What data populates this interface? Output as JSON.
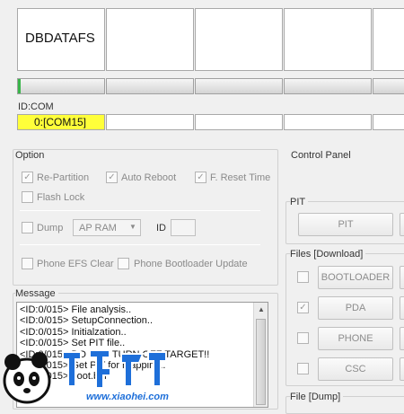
{
  "port_header": {
    "slot1_label": "DBDATAFS"
  },
  "progress": {
    "slot1_fill": 0.03
  },
  "idcom": {
    "label": "ID:COM",
    "slot1_value": "0:[COM15]"
  },
  "option": {
    "title": "Option",
    "repartition": "Re-Partition",
    "auto_reboot": "Auto Reboot",
    "f_reset_time": "F. Reset Time",
    "flash_lock": "Flash Lock",
    "dump": "Dump",
    "dump_select": "AP RAM",
    "id_label": "ID",
    "phone_efs_clear": "Phone EFS Clear",
    "phone_bootloader_update": "Phone Bootloader Update"
  },
  "message": {
    "title": "Message",
    "lines": [
      "<ID:0/015> File analysis..",
      "<ID:0/015> SetupConnection..",
      "<ID:0/015> Initialzation..",
      "<ID:0/015> Set PIT file..",
      "<ID:0/015> DO NOT TURN OFF TARGET!!",
      "<ID:0/015> Get PIT for mapping..",
      "<ID:0/015> boot.bin"
    ]
  },
  "control_panel": {
    "title": "Control Panel"
  },
  "pit": {
    "title": "PIT",
    "button": "PIT"
  },
  "files_download": {
    "title": "Files [Download]",
    "bootloader": "BOOTLOADER",
    "pda": "PDA",
    "phone": "PHONE",
    "csc": "CSC"
  },
  "files_dump": {
    "title": "File [Dump]"
  },
  "watermark": {
    "text": "www.xiaohei.com"
  },
  "colors": {
    "com_highlight": "#ffff3a",
    "progress_green": "#39b54a",
    "watermark_blue": "#1e6fd9"
  }
}
